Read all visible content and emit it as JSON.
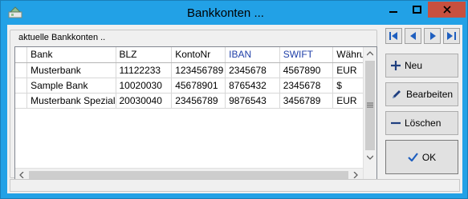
{
  "window": {
    "title": "Bankkonten ..."
  },
  "group": {
    "label": "aktuelle Bankkonten .."
  },
  "table": {
    "columns": [
      "Bank",
      "BLZ",
      "KontoNr",
      "IBAN",
      "SWIFT",
      "Währung"
    ],
    "rows": [
      [
        "Musterbank",
        "11122233",
        "123456789",
        "2345678",
        "4567890",
        "EUR"
      ],
      [
        "Sample Bank",
        "10020030",
        "45678901",
        "8765432",
        "2345678",
        "$"
      ],
      [
        "Musterbank Spezial",
        "20030040",
        "23456789",
        "9876543",
        "3456789",
        "EUR"
      ]
    ]
  },
  "buttons": {
    "new_label": "Neu",
    "edit_label": "Bearbeiten",
    "delete_label": "Löschen",
    "ok_label": "OK"
  },
  "colors": {
    "titlebar": "#22a1e6",
    "close": "#c7503f",
    "accent_icon": "#1f5fbf"
  }
}
